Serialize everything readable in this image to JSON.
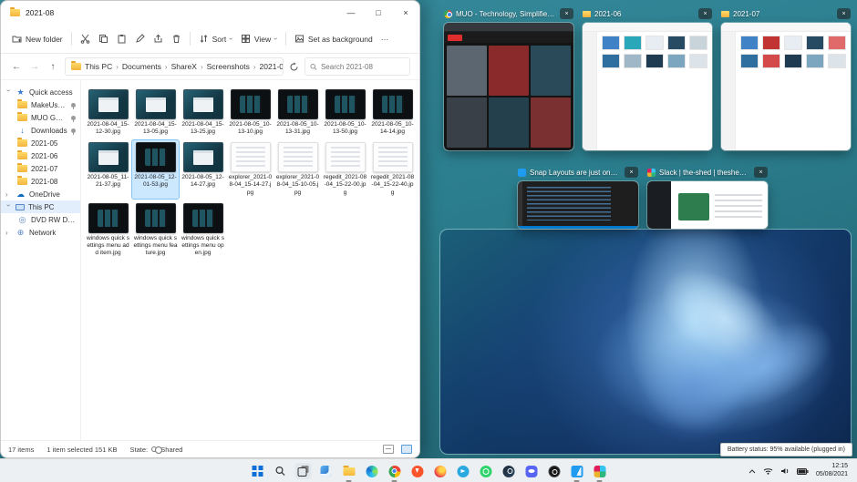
{
  "explorer": {
    "title": "2021-08",
    "toolbar": {
      "new_folder_label": "New folder",
      "sort_label": "Sort",
      "view_label": "View",
      "set_background_label": "Set as background"
    },
    "breadcrumb": [
      "This PC",
      "Documents",
      "ShareX",
      "Screenshots",
      "2021-08"
    ],
    "search_placeholder": "Search 2021-08",
    "sidebar": {
      "items": [
        {
          "label": "Quick access"
        },
        {
          "label": "MakeUseOf"
        },
        {
          "label": "MUO GD Screen"
        },
        {
          "label": "Downloads"
        },
        {
          "label": "2021-05"
        },
        {
          "label": "2021-06"
        },
        {
          "label": "2021-07"
        },
        {
          "label": "2021-08"
        },
        {
          "label": "OneDrive"
        },
        {
          "label": "This PC"
        },
        {
          "label": "DVD RW Drive (D:) A"
        },
        {
          "label": "Network"
        }
      ]
    },
    "files": [
      {
        "name": "2021-08-04_15-12-30.jpg",
        "variant": "mixed",
        "state": ""
      },
      {
        "name": "2021-08-04_15-13-05.jpg",
        "variant": "mixed",
        "state": ""
      },
      {
        "name": "2021-08-04_15-13-25.jpg",
        "variant": "mixed",
        "state": ""
      },
      {
        "name": "2021-08-05_10-13-10.jpg",
        "variant": "dark",
        "state": ""
      },
      {
        "name": "2021-08-05_10-13-31.jpg",
        "variant": "dark",
        "state": ""
      },
      {
        "name": "2021-08-05_10-13-50.jpg",
        "variant": "dark",
        "state": ""
      },
      {
        "name": "2021-08-05_10-14-14.jpg",
        "variant": "dark",
        "state": ""
      },
      {
        "name": "2021-08-05_11-21-37.jpg",
        "variant": "mixed",
        "state": ""
      },
      {
        "name": "2021-08-05_12-01-53.jpg",
        "variant": "dark",
        "state": "selected"
      },
      {
        "name": "2021-08-05_12-14-27.jpg",
        "variant": "mixed",
        "state": ""
      },
      {
        "name": "explorer_2021-08-04_15-14-27.jpg",
        "variant": "light",
        "state": ""
      },
      {
        "name": "explorer_2021-08-04_15-10-05.jpg",
        "variant": "light",
        "state": ""
      },
      {
        "name": "regedit_2021-08-04_15-22-00.jpg",
        "variant": "light",
        "state": ""
      },
      {
        "name": "regedit_2021-08-04_15-22-40.jpg",
        "variant": "light",
        "state": ""
      },
      {
        "name": "windows quick settings menu add item.jpg",
        "variant": "dark",
        "state": ""
      },
      {
        "name": "windows quick settings menu feature.jpg",
        "variant": "dark",
        "state": ""
      },
      {
        "name": "windows quick settings menu open.jpg",
        "variant": "dark",
        "state": ""
      }
    ],
    "status": {
      "items_count": "17 items",
      "selection": "1 item selected 151 KB",
      "state_label": "State:",
      "state_value": "Shared"
    }
  },
  "taskview": {
    "windows": [
      {
        "title": "MUO - Technology, Simplified. - Goog...",
        "app": "chrome"
      },
      {
        "title": "2021-06",
        "app": "file-explorer"
      },
      {
        "title": "2021-07",
        "app": "file-explorer"
      },
      {
        "title": "Snap Layouts are just one of...",
        "app": "vscode"
      },
      {
        "title": "Slack | the-shed | theshed place",
        "app": "slack"
      }
    ],
    "browser_brand": "MUO"
  },
  "desktop": {
    "battery_tooltip": "Battery status: 95% available (plugged in)"
  },
  "taskbar": {
    "icons": [
      {
        "name": "start"
      },
      {
        "name": "search"
      },
      {
        "name": "task-view"
      },
      {
        "name": "widgets"
      },
      {
        "name": "file-explorer"
      },
      {
        "name": "edge"
      },
      {
        "name": "chrome"
      },
      {
        "name": "brave"
      },
      {
        "name": "firefox"
      },
      {
        "name": "telegram"
      },
      {
        "name": "whatsapp"
      },
      {
        "name": "steam"
      },
      {
        "name": "discord"
      },
      {
        "name": "obs"
      },
      {
        "name": "vscode"
      },
      {
        "name": "slack"
      }
    ],
    "tray": {
      "time": "12:15",
      "date": "05/08/2021"
    }
  },
  "icons": {
    "back": "←",
    "forward": "→",
    "up": "↑",
    "breadcrumb_chevron": "›",
    "dropdown_chevron": "›",
    "expand_chevron": "›",
    "star": "★",
    "cloud": "☁",
    "disc": "◎",
    "network": "⊕",
    "downloads": "↓",
    "minimize": "—",
    "maximize": "□",
    "close": "×",
    "more": "···"
  },
  "colors": {
    "accent": "#0078d4",
    "selection": "#cce8ff",
    "taskview_backdrop": "#2b7e8e",
    "wallpaper_base": "#0e2c57"
  }
}
